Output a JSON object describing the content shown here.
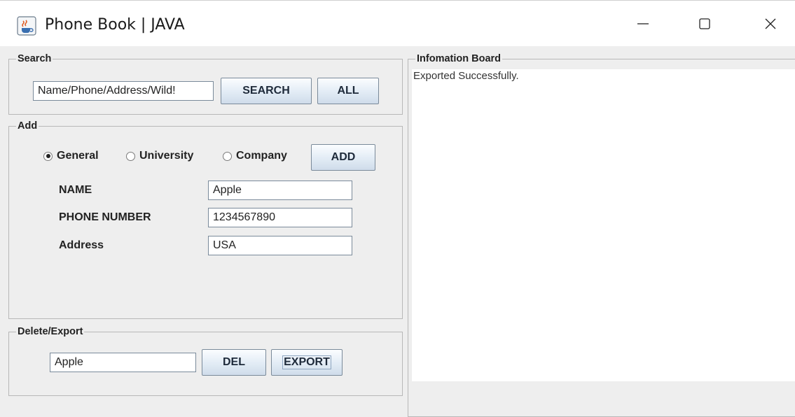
{
  "window": {
    "title": "Phone Book | JAVA",
    "icon": "java-coffee-icon"
  },
  "search": {
    "legend": "Search",
    "input_value": "Name/Phone/Address/Wild!",
    "search_label": "SEARCH",
    "all_label": "ALL"
  },
  "add": {
    "legend": "Add",
    "radios": [
      {
        "label": "General",
        "checked": true
      },
      {
        "label": "University",
        "checked": false
      },
      {
        "label": "Company",
        "checked": false
      }
    ],
    "add_label": "ADD",
    "fields": [
      {
        "label": "NAME",
        "value": "Apple"
      },
      {
        "label": "PHONE NUMBER",
        "value": "1234567890"
      },
      {
        "label": "Address",
        "value": "USA"
      }
    ]
  },
  "delete_export": {
    "legend": "Delete/Export",
    "input_value": "Apple",
    "del_label": "DEL",
    "export_label": "EXPORT"
  },
  "info": {
    "legend": "Infomation Board",
    "message": "Exported Successfully."
  }
}
